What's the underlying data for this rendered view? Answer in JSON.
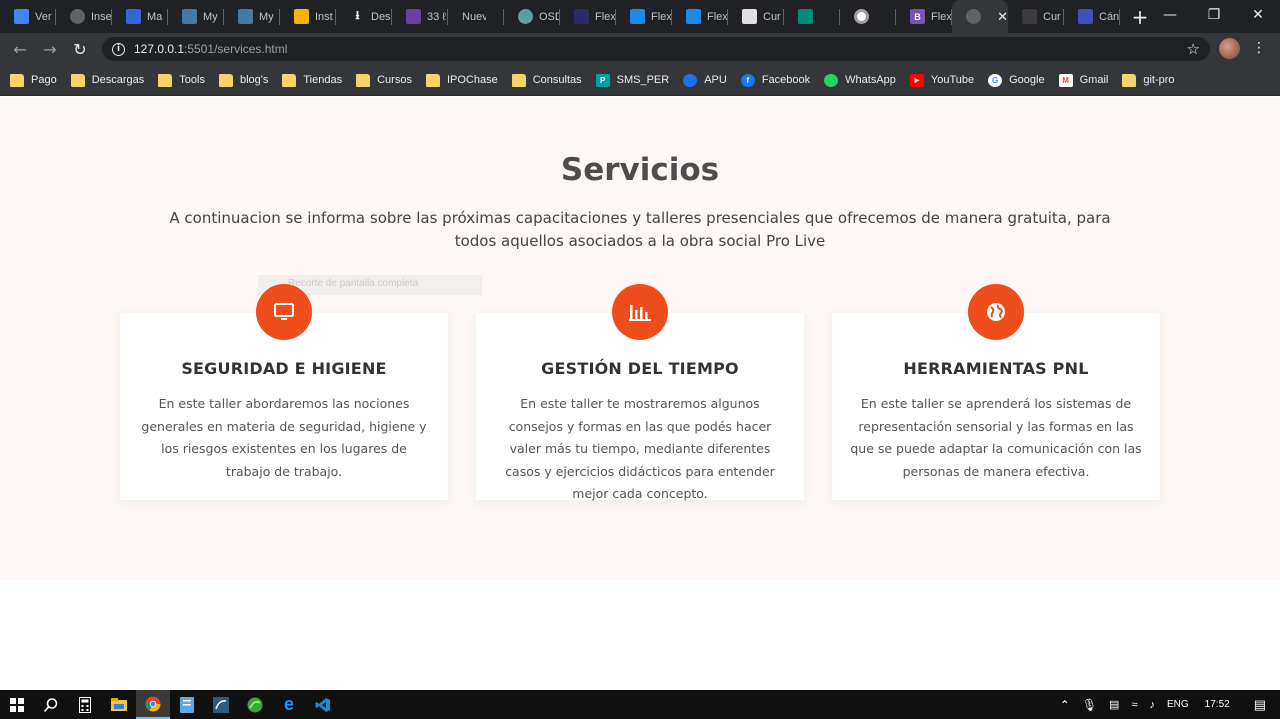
{
  "browser": {
    "tabs": [
      {
        "title": "Ver",
        "icon": "flag-icon",
        "color": "#4285f4"
      },
      {
        "title": "Inse",
        "icon": "globe-icon",
        "color": "#5f6368"
      },
      {
        "title": "Ma",
        "icon": "table-icon",
        "color": "#3367d6"
      },
      {
        "title": "My",
        "icon": "mysql-icon",
        "color": "#4479a1"
      },
      {
        "title": "My",
        "icon": "mysql-icon",
        "color": "#4479a1"
      },
      {
        "title": "Inst",
        "icon": "slides-icon",
        "color": "#f4b400"
      },
      {
        "title": "Des",
        "icon": "download-icon",
        "color": "#202124"
      },
      {
        "title": "33 ℓ",
        "icon": "site-icon",
        "color": "#6b3fa0"
      },
      {
        "title": "Nueva p",
        "icon": "",
        "color": ""
      },
      {
        "title": "OSD",
        "icon": "globe-icon",
        "color": "#5f9ea0"
      },
      {
        "title": "Flex",
        "icon": "code-icon",
        "color": "#2b2b6b"
      },
      {
        "title": "Flex",
        "icon": "flexbox-icon",
        "color": "#1e88e5"
      },
      {
        "title": "Flex",
        "icon": "flexbox-icon",
        "color": "#1e88e5"
      },
      {
        "title": "Cur",
        "icon": "course-icon",
        "color": "#e0e0e0"
      },
      {
        "title": "",
        "icon": "meet-icon",
        "color": "#00897b"
      },
      {
        "title": "",
        "icon": "record-icon",
        "color": "#9e9e9e"
      },
      {
        "title": "Flex",
        "icon": "bootstrap-icon",
        "color": "#7952b3"
      },
      {
        "title": "",
        "icon": "globe-icon",
        "color": "#5f6368",
        "active": true
      },
      {
        "title": "Cur",
        "icon": "course-icon",
        "color": "#3c3c3c"
      },
      {
        "title": "Cán",
        "icon": "hex-icon",
        "color": "#3f51b5"
      }
    ],
    "new_tab": "+",
    "url_host": "127.0.0.1",
    "url_path": ":5501/services.html"
  },
  "bookmarks": [
    {
      "label": "Pago",
      "icon": "folder-icon"
    },
    {
      "label": "Descargas",
      "icon": "folder-icon"
    },
    {
      "label": "Tools",
      "icon": "folder-icon"
    },
    {
      "label": "blog's",
      "icon": "folder-icon"
    },
    {
      "label": "Tiendas",
      "icon": "folder-icon"
    },
    {
      "label": "Cursos",
      "icon": "folder-icon"
    },
    {
      "label": "IPOChase",
      "icon": "folder-icon"
    },
    {
      "label": "Consultas",
      "icon": "folder-icon"
    },
    {
      "label": "SMS_PER",
      "icon": "sms-icon",
      "color": "#00a3a3"
    },
    {
      "label": "APU",
      "icon": "apu-icon",
      "color": "#1a73e8"
    },
    {
      "label": "Facebook",
      "icon": "facebook-icon",
      "color": "#1877f2"
    },
    {
      "label": "WhatsApp",
      "icon": "whatsapp-icon",
      "color": "#25d366"
    },
    {
      "label": "YouTube",
      "icon": "youtube-icon",
      "color": "#ff0000"
    },
    {
      "label": "Google",
      "icon": "google-icon",
      "color": "#ffffff"
    },
    {
      "label": "Gmail",
      "icon": "gmail-icon",
      "color": "#ea4335"
    },
    {
      "label": "git-pro",
      "icon": "folder-icon"
    }
  ],
  "page": {
    "title": "Servicios",
    "lead": "A continuacion se informa sobre las próximas capacitaciones y talleres presenciales que ofrecemos de manera gratuita, para todos aquellos asociados a la obra social Pro Live",
    "overlay_text": "Recorte de pantalla completa",
    "accent": "#f04d1c",
    "cards": [
      {
        "icon": "monitor-icon",
        "title": "SEGURIDAD E HIGIENE",
        "text": "En este taller abordaremos las nociones generales en materia de seguridad, higiene y los riesgos existentes en los lugares de trabajo de trabajo."
      },
      {
        "icon": "chart-bars-icon",
        "title": "GESTIÓN DEL TIEMPO",
        "text": "En este taller te mostraremos algunos consejos y formas en las que podés hacer valer más tu tiempo, mediante diferentes casos y ejercicios didácticos para entender mejor cada concepto."
      },
      {
        "icon": "globe-icon",
        "title": "HERRAMIENTAS PNL",
        "text": "En este taller se aprenderá los sistemas de representación sensorial y las formas en las que se puede adaptar la comunicación con las personas de manera efectiva."
      }
    ]
  },
  "taskbar": {
    "language": "ENG",
    "time": "17:52"
  }
}
